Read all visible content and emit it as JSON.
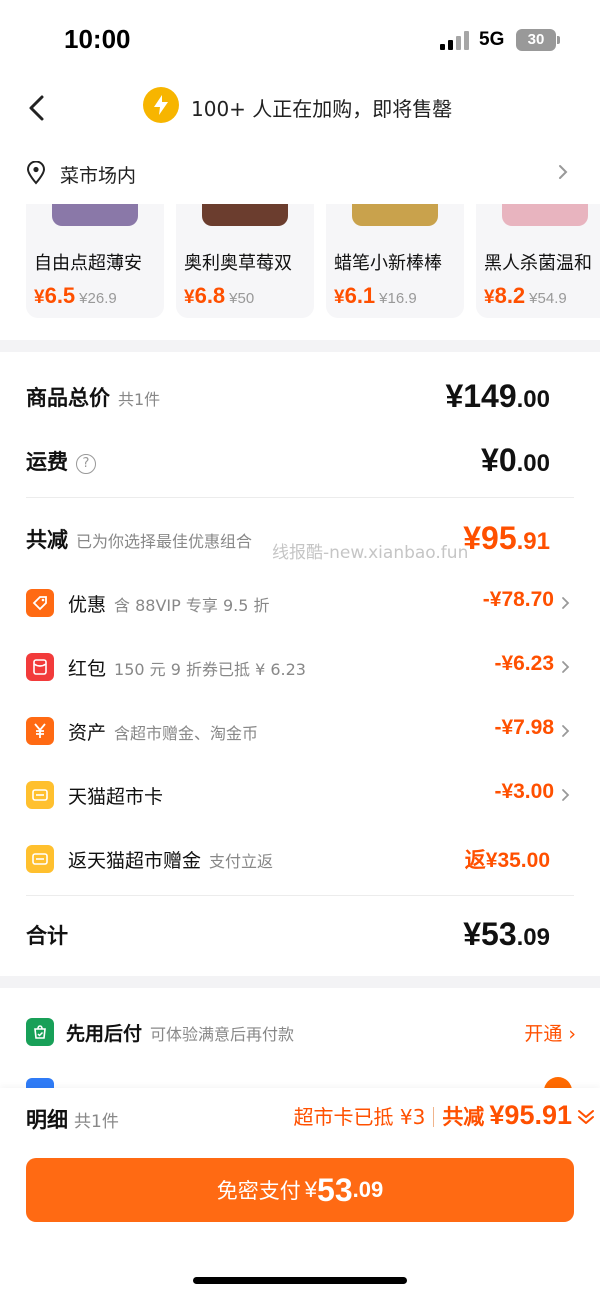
{
  "status_bar": {
    "time": "10:00",
    "network": "5G",
    "battery": "30"
  },
  "nav": {
    "title": "100+ 人正在加购，即将售罄"
  },
  "location": {
    "label": "菜市场内"
  },
  "products": [
    {
      "name": "自由点超薄安",
      "yen": "¥",
      "price": "6.5",
      "original": "¥26.9",
      "thumb_color": "#8a78a8"
    },
    {
      "name": "奥利奥草莓双",
      "yen": "¥",
      "price": "6.8",
      "original": "¥50",
      "thumb_color": "#6b3d2e"
    },
    {
      "name": "蜡笔小新棒棒",
      "yen": "¥",
      "price": "6.1",
      "original": "¥16.9",
      "thumb_color": "#c9a24c"
    },
    {
      "name": "黑人杀菌温和",
      "yen": "¥",
      "price": "8.2",
      "original": "¥54.9",
      "thumb_color": "#e8b4bf"
    }
  ],
  "summary": {
    "goods_total": {
      "label": "商品总价",
      "sub": "共1件",
      "int": "¥149",
      "dec": ".00"
    },
    "shipping": {
      "label": "运费",
      "help": "?",
      "int": "¥0",
      "dec": ".00"
    },
    "total_reduction": {
      "label": "共减",
      "sub": "已为你选择最佳优惠组合",
      "int": "¥95",
      "dec": ".91"
    },
    "discounts": [
      {
        "label": "优惠",
        "sub": "含 88VIP 专享 9.5 折",
        "amount": "-¥78.70",
        "icon": "tag-icon",
        "color": "#ff6a13"
      },
      {
        "label": "红包",
        "sub": "150 元 9 折券已抵 ¥ 6.23",
        "amount": "-¥6.23",
        "icon": "red-packet-icon",
        "color": "#f23b3b"
      },
      {
        "label": "资产",
        "sub": "含超市赠金、淘金币",
        "amount": "-¥7.98",
        "icon": "yen-coin-icon",
        "color": "#ff6a13"
      },
      {
        "label": "天猫超市卡",
        "sub": "",
        "amount": "-¥3.00",
        "icon": "supermarket-card-icon",
        "color": "#ffc02e"
      },
      {
        "label": "返天猫超市赠金",
        "sub": "支付立返",
        "amount": "返¥35.00",
        "icon": "gift-card-icon",
        "color": "#ffc02e"
      }
    ],
    "grand_total": {
      "label": "合计",
      "int": "¥53",
      "dec": ".09"
    }
  },
  "watermark": "线报酷-new.xianbao.fun",
  "pay_later": {
    "label": "先用后付",
    "sub": "可体验满意后再付款",
    "action": "开通 ›"
  },
  "bottom": {
    "detail_label": "明细",
    "detail_sub": "共1件",
    "card_used": "超市卡已抵 ¥3",
    "total_reduce_label": "共减",
    "total_reduce_amount": "¥95.91",
    "pay_label": "免密支付",
    "pay_yen": "¥",
    "pay_int": "53",
    "pay_dec": ".09"
  },
  "colors": {
    "accent": "#ff5000",
    "button": "#ff6a13",
    "brand_yellow": "#f7b500"
  }
}
